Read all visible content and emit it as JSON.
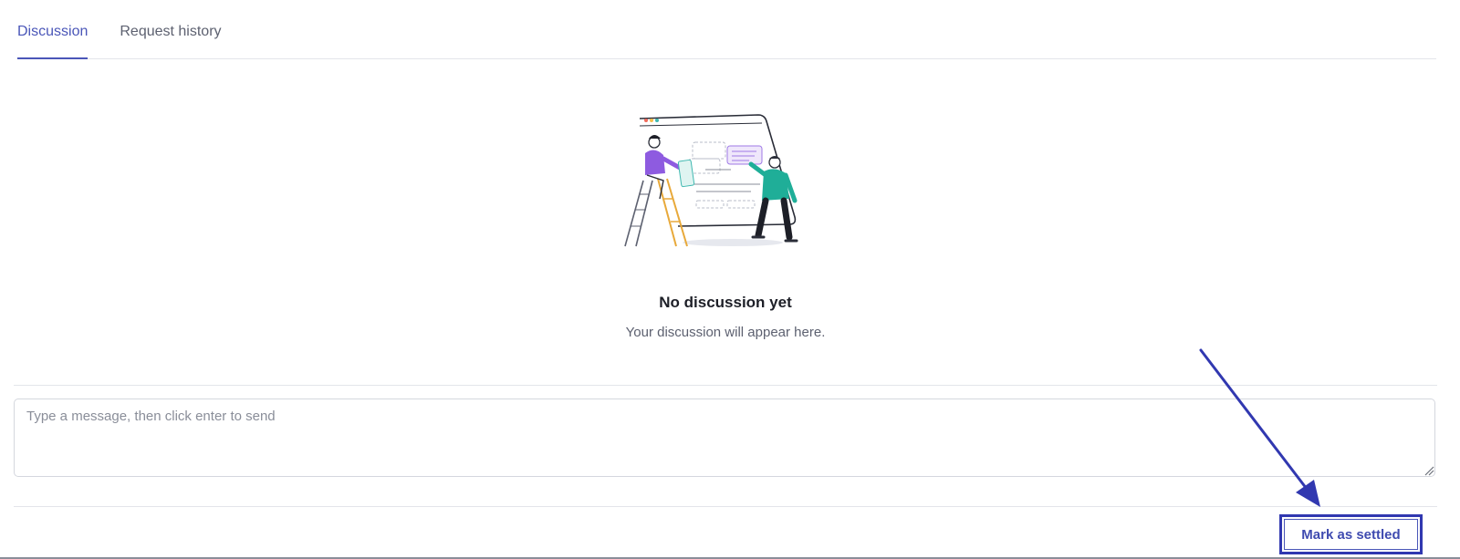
{
  "tabs": [
    {
      "label": "Discussion",
      "active": true
    },
    {
      "label": "Request history",
      "active": false
    }
  ],
  "empty_state": {
    "illustration": "people-building-board-illustration",
    "title": "No discussion yet",
    "subtitle": "Your discussion will appear here."
  },
  "composer": {
    "placeholder": "Type a message, then click enter to send",
    "value": ""
  },
  "actions": {
    "settle_label": "Mark as settled"
  },
  "colors": {
    "accent": "#4a56b8",
    "annotation": "#3138b0",
    "divider": "#e3e5ea"
  }
}
